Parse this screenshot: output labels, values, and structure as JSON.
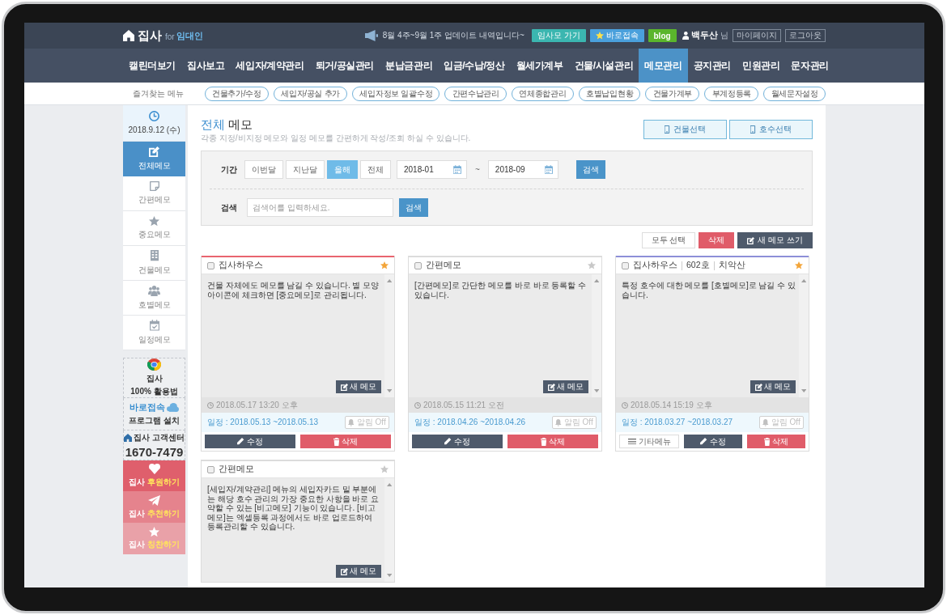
{
  "header": {
    "logo": {
      "name": "집사",
      "suffix": "for",
      "audience": "임대인"
    },
    "notice": "8월 4주~9월 1주 업데이트 내역입니다~",
    "links": [
      {
        "label": "임사모 가기",
        "kind": "community"
      },
      {
        "label": "바로접속",
        "kind": "remote"
      },
      {
        "label": "blog",
        "kind": "blog"
      }
    ],
    "user": {
      "name": "백두산",
      "suffix": "님"
    },
    "account_links": [
      "마이페이지",
      "로그아웃"
    ]
  },
  "nav": [
    {
      "label": "캘린더보기",
      "selected": false
    },
    {
      "label": "집사보고",
      "selected": false
    },
    {
      "label": "세입자/계약관리",
      "selected": false
    },
    {
      "label": "퇴거/공실관리",
      "selected": false
    },
    {
      "label": "분납금관리",
      "selected": false
    },
    {
      "label": "입금/수납/정산",
      "selected": false
    },
    {
      "label": "월세가계부",
      "selected": false
    },
    {
      "label": "건물/시설관리",
      "selected": false
    },
    {
      "label": "메모관리",
      "selected": true
    },
    {
      "label": "공지관리",
      "selected": false
    },
    {
      "label": "민원관리",
      "selected": false
    },
    {
      "label": "문자관리",
      "selected": false
    }
  ],
  "favorites": {
    "label": "즐겨찾는 메뉴",
    "items": [
      "건물추가/수정",
      "세입자/공실 추가",
      "세입자정보 일괄수정",
      "간편수납관리",
      "연체종합관리",
      "호별납입현황",
      "건물가계부",
      "부계정등록",
      "월세문자설정"
    ]
  },
  "sidebar": {
    "date": "2018.9.12 (수)",
    "items": [
      {
        "label": "전체메모",
        "kind": "all",
        "selected": true
      },
      {
        "label": "간편메모",
        "kind": "quick",
        "selected": false
      },
      {
        "label": "중요메모",
        "kind": "important",
        "selected": false
      },
      {
        "label": "건물메모",
        "kind": "building",
        "selected": false
      },
      {
        "label": "호별메모",
        "kind": "unit",
        "selected": false
      },
      {
        "label": "일정메모",
        "kind": "schedule",
        "selected": false
      }
    ],
    "help_links": [
      {
        "kind": "guide",
        "title": "집사",
        "subtitle": "100% 활용법"
      },
      {
        "kind": "remote",
        "title": "바로접속",
        "subtitle": "프로그램 설치"
      },
      {
        "kind": "support",
        "title": "집사 고객센터",
        "subtitle": "1670-7479"
      }
    ],
    "promos": [
      {
        "kind": "support",
        "prefix": "집사",
        "action": "후원하기"
      },
      {
        "kind": "recommend",
        "prefix": "집사",
        "action": "추천하기"
      },
      {
        "kind": "praise",
        "prefix": "집사",
        "action": "칭찬하기"
      }
    ]
  },
  "page": {
    "title_accent": "전체",
    "title_rest": "메모",
    "subtitle": "각종 지정/비지정 메모와 일정 메모를 간편하게 작성/조회 하실 수 있습니다.",
    "select_buttons": [
      "건물선택",
      "호수선택"
    ]
  },
  "filter": {
    "period_label": "기간",
    "periods": [
      {
        "label": "이번달",
        "selected": false
      },
      {
        "label": "지난달",
        "selected": false
      },
      {
        "label": "올해",
        "selected": true
      },
      {
        "label": "전체",
        "selected": false
      }
    ],
    "date_from": "2018-01",
    "date_separator": "~",
    "date_to": "2018-09",
    "period_button": "검색",
    "search": {
      "label": "검색",
      "placeholder": "검색어를 입력하세요.",
      "button": "검색"
    }
  },
  "actions": [
    {
      "label": "모두 선택",
      "kind": "select_all"
    },
    {
      "label": "삭제",
      "kind": "delete"
    },
    {
      "label": "새 메모 쓰기",
      "kind": "new"
    }
  ],
  "memos": [
    {
      "title": [
        "집사하우스"
      ],
      "checked": false,
      "starred": true,
      "color": "#e8646f",
      "text": "건물 자체에도 메모를 남길 수 있습니다. 별 모양 아이콘에 체크하면 [중요메모]로 관리됩니다.",
      "new_memo": "새 메모",
      "time": "2018.05.17 13:20 오후",
      "schedule": "일정 : 2018.05.13 ~2018.05.13",
      "alarm": {
        "label": "알림 Off",
        "on": false
      },
      "buttons": [
        {
          "label": "수정",
          "kind": "edit"
        },
        {
          "label": "삭제",
          "kind": "delete"
        }
      ]
    },
    {
      "title": [
        "간편메모"
      ],
      "checked": false,
      "starred": false,
      "color": "#dcdcdc",
      "text": "[간편메모]로 간단한 메모를 바로 바로 등록할 수 있습니다.",
      "new_memo": "새 메모",
      "time": "2018.05.15 11:21 오전",
      "schedule": "일정 : 2018.04.26 ~2018.04.26",
      "alarm": {
        "label": "알림 Off",
        "on": false
      },
      "buttons": [
        {
          "label": "수정",
          "kind": "edit"
        },
        {
          "label": "삭제",
          "kind": "delete"
        }
      ]
    },
    {
      "title": [
        "집사하우스",
        "602호",
        "치악산"
      ],
      "checked": false,
      "starred": true,
      "color": "#8d8fd8",
      "text": "특정 호수에 대한 메모를 [호별메모]로 남길 수 있습니다.",
      "new_memo": "새 메모",
      "time": "2018.05.14 15:19 오후",
      "schedule": "일정 : 2018.03.27 ~2018.03.27",
      "alarm": {
        "label": "알림 Off",
        "on": false
      },
      "buttons": [
        {
          "label": "기타메뉴",
          "kind": "menu"
        },
        {
          "label": "수정",
          "kind": "edit"
        },
        {
          "label": "삭제",
          "kind": "delete"
        }
      ]
    },
    {
      "title": [
        "간편메모"
      ],
      "checked": false,
      "starred": false,
      "color": "#dcdcdc",
      "text": "[세입자/계약관리] 메뉴의 세입자카드 밑 부분에는 해당 호수 관리의 가장 중요한 사항을 바로 요약할 수 있는 [비고메모] 기능이 있습니다. [비고메모]는 엑셀등록 과정에서도 바로 업로드하여 등록관리할 수 있습니다.",
      "new_memo": "새 메모"
    }
  ]
}
